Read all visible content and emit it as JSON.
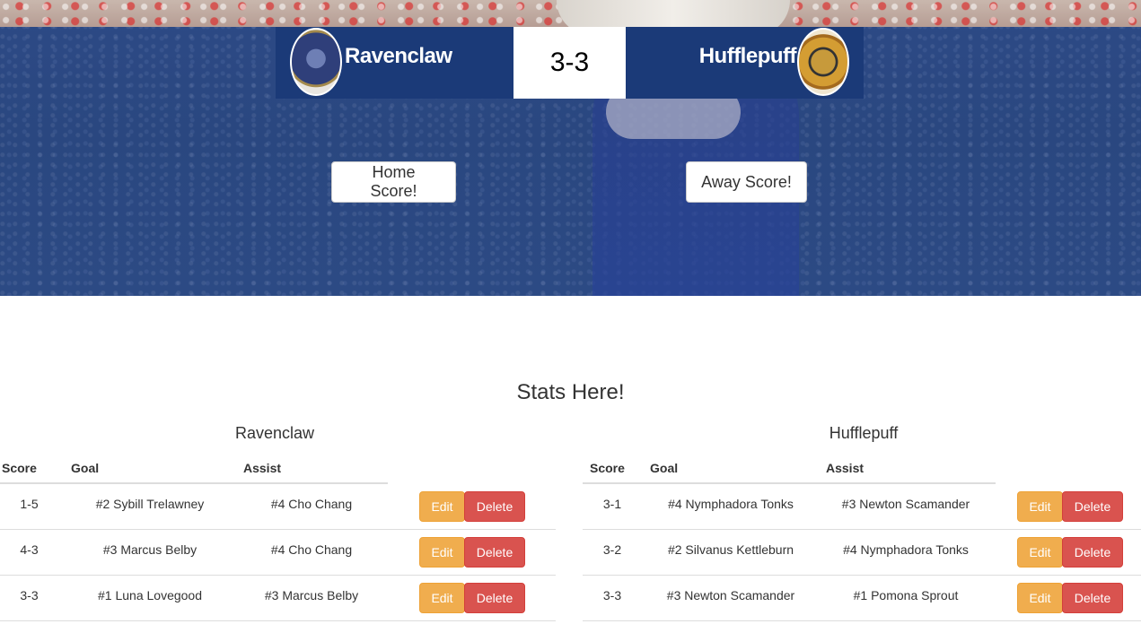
{
  "scoreboard": {
    "home_team": "Ravenclaw",
    "away_team": "Hufflepuff",
    "score": "3-3"
  },
  "buttons": {
    "home_score": "Home Score!",
    "away_score": "Away Score!",
    "edit": "Edit",
    "delete": "Delete"
  },
  "stats": {
    "title": "Stats Here!",
    "columns": {
      "score": "Score",
      "goal": "Goal",
      "assist": "Assist"
    },
    "home": {
      "team": "Ravenclaw",
      "rows": [
        {
          "score": "1-5",
          "goal": "#2 Sybill Trelawney",
          "assist": "#4 Cho Chang"
        },
        {
          "score": "4-3",
          "goal": "#3 Marcus Belby",
          "assist": "#4 Cho Chang"
        },
        {
          "score": "3-3",
          "goal": "#1 Luna Lovegood",
          "assist": "#3 Marcus Belby"
        }
      ]
    },
    "away": {
      "team": "Hufflepuff",
      "rows": [
        {
          "score": "3-1",
          "goal": "#4 Nymphadora Tonks",
          "assist": "#3 Newton Scamander"
        },
        {
          "score": "3-2",
          "goal": "#2 Silvanus Kettleburn",
          "assist": "#4 Nymphadora Tonks"
        },
        {
          "score": "3-3",
          "goal": "#3 Newton Scamander",
          "assist": "#1 Pomona Sprout"
        }
      ]
    }
  },
  "colors": {
    "scoreboard_bg": "#1b3a78",
    "edit_button": "#f0ad4e",
    "delete_button": "#d9534f"
  }
}
